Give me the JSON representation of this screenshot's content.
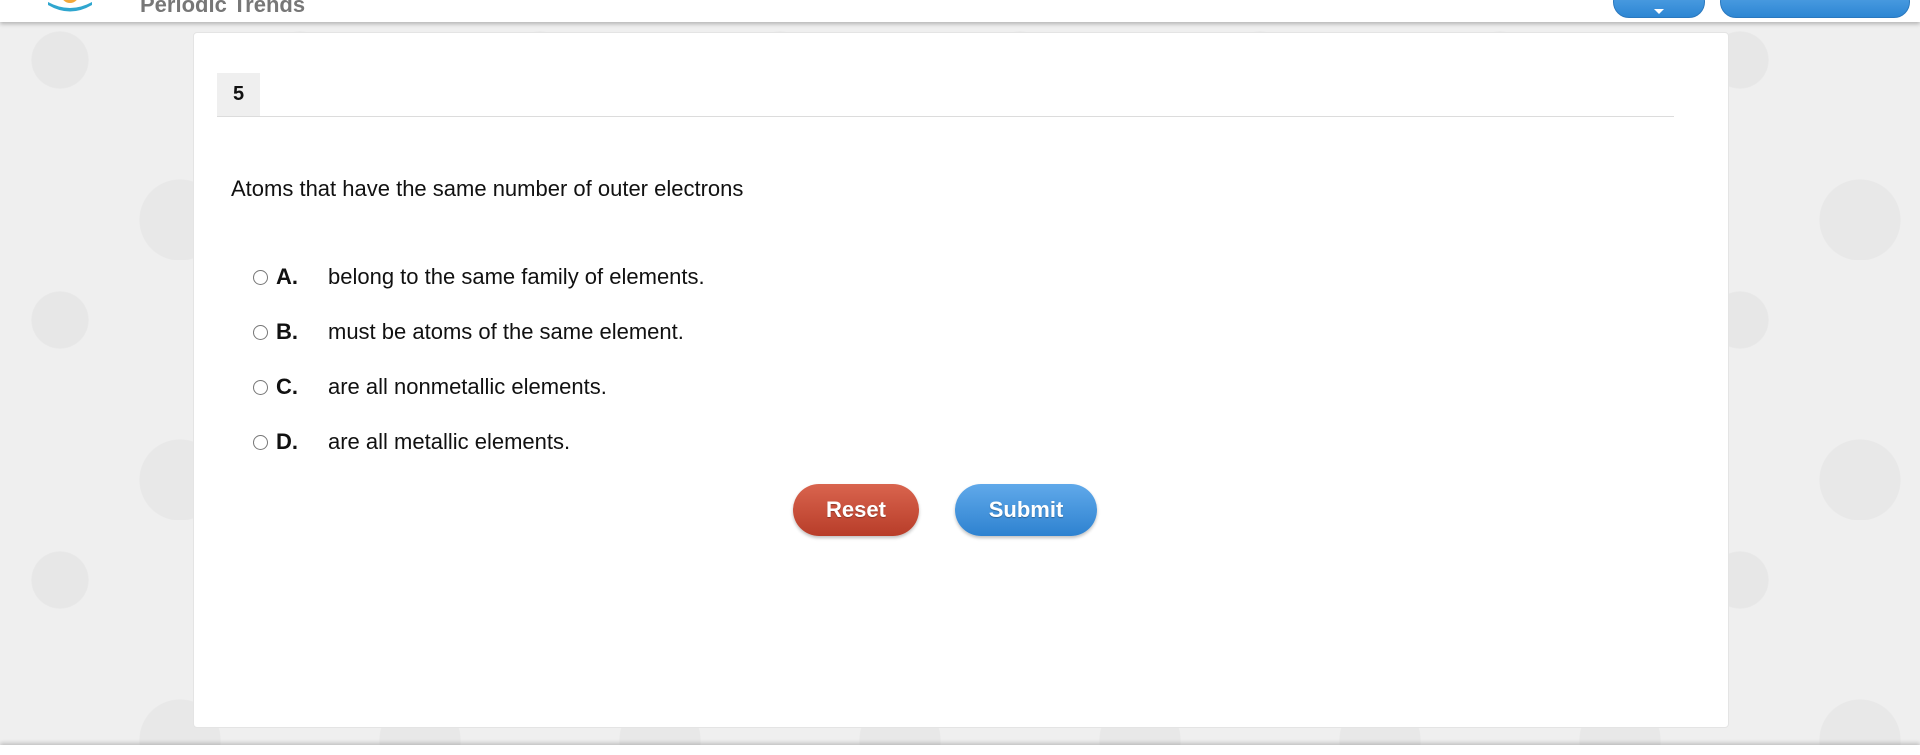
{
  "header": {
    "app_title": "Periodic Trends",
    "icons": {
      "logo": "sun-logo-icon",
      "dropdown": "chevron-down-icon"
    }
  },
  "question": {
    "number": "5",
    "prompt": "Atoms that have the same number of outer electrons",
    "choices": [
      {
        "letter": "A.",
        "text": "belong to the same family of elements."
      },
      {
        "letter": "B.",
        "text": "must be atoms of the same element."
      },
      {
        "letter": "C.",
        "text": "are all nonmetallic elements."
      },
      {
        "letter": "D.",
        "text": "are all metallic elements."
      }
    ]
  },
  "actions": {
    "reset_label": "Reset",
    "submit_label": "Submit"
  },
  "colors": {
    "reset": "#c44b35",
    "submit": "#3b8fdc",
    "header_button": "#3b8fdc",
    "background": "#efefef"
  }
}
